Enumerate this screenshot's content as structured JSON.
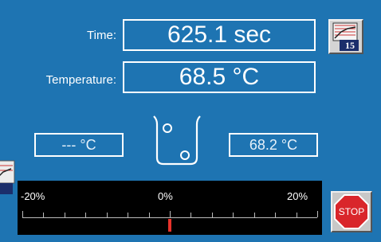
{
  "labels": {
    "time": "Time:",
    "temperature": "Temperature:"
  },
  "readouts": {
    "time": "625.1 sec",
    "temperature": "68.5 °C",
    "left_probe": "--- °C",
    "right_probe": "68.2 °C"
  },
  "graph_button": {
    "badge": "15"
  },
  "scale": {
    "min_label": "-20%",
    "mid_label": "0%",
    "max_label": "20%",
    "min": -20,
    "max": 20,
    "indicator_value": 0
  },
  "stop_button": {
    "label": "STOP"
  },
  "colors": {
    "background": "#1e74b2",
    "indicator": "#e8322b",
    "stop": "#d9262b"
  }
}
